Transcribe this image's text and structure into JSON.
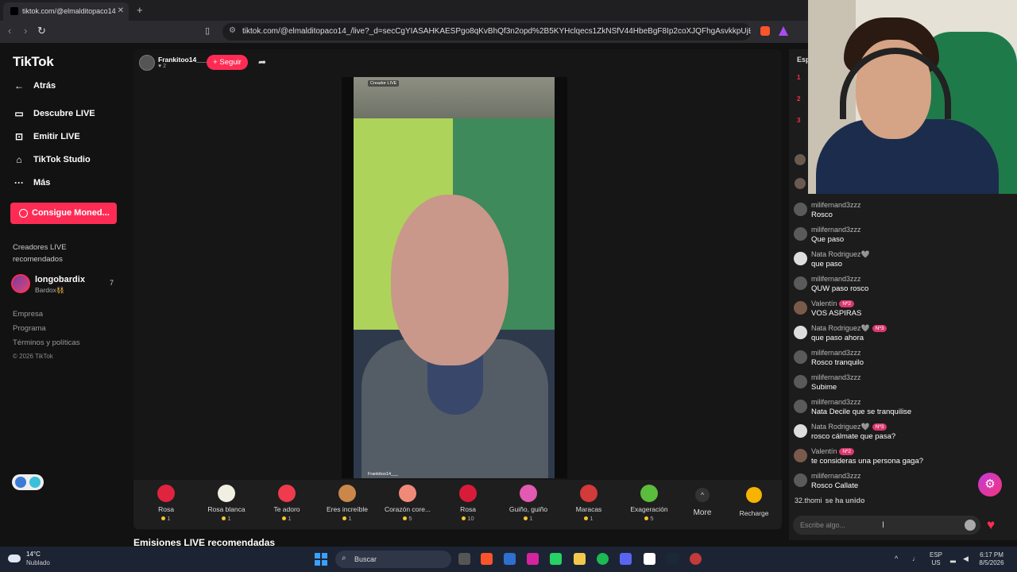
{
  "browser": {
    "tab_title": "tiktok.com/@elmalditopaco14",
    "tab_close": "✕",
    "new_tab": "+",
    "url": "tiktok.com/@elmalditopaco14_/live?_d=secCgYIASAHKAESPgo8qKvBhQf3n2opd%2B5KYHclqecs1ZkNSfV44HbeBgF8Ip2coXJQFhgAsvkkpUjEZaVP4MpOl..."
  },
  "sidebar": {
    "logo": "TikTok",
    "back": "Atrás",
    "nav": [
      {
        "label": "Descubre LIVE",
        "icon": "▭"
      },
      {
        "label": "Emitir LIVE",
        "icon": "⊡"
      },
      {
        "label": "TikTok Studio",
        "icon": "⌂"
      },
      {
        "label": "Más",
        "icon": "···"
      }
    ],
    "coins_button": "Consigue Moned...",
    "recommended_title": "Creadores LIVE recomendados",
    "creator": {
      "name": "longobardix",
      "sub": "Bardox👯",
      "count": "7"
    },
    "footer": [
      "Empresa",
      "Programa",
      "Términos y políticas"
    ],
    "copyright": "© 2026 TikTok"
  },
  "live": {
    "host_name": "Frankitoo14___",
    "host_likes": "♥ 2",
    "follow": "+ Seguir",
    "creator_tag": "Creador LIVE",
    "video_name": "Frankitoo14___"
  },
  "gifts": [
    {
      "name": "Rosa",
      "price": "1",
      "color": "#e0233f"
    },
    {
      "name": "Rosa blanca",
      "price": "1",
      "color": "#f1efe2"
    },
    {
      "name": "Te adoro",
      "price": "1",
      "color": "#ef3b4d"
    },
    {
      "name": "Eres increíble",
      "price": "1",
      "color": "#c9884a"
    },
    {
      "name": "Corazón core...",
      "price": "5",
      "color": "#f08a78"
    },
    {
      "name": "Rosa",
      "price": "10",
      "color": "#d81b3a"
    },
    {
      "name": "Guiño, guiño",
      "price": "1",
      "color": "#e25ab1"
    },
    {
      "name": "Maracas",
      "price": "1",
      "color": "#d33a3a"
    },
    {
      "name": "Exageración",
      "price": "5",
      "color": "#5cbc3d"
    }
  ],
  "gift_more": "More",
  "gift_more_icon": "^",
  "recharge": "Recharge",
  "recommended_streams": "Emisiones LIVE recomendadas",
  "chat": {
    "header": "Esp",
    "ranks": [
      "1",
      "2",
      "3"
    ],
    "messages": [
      {
        "user": "milifernand3zzz",
        "badge": "",
        "text": "Rosco",
        "avatar": "#5a5a5a"
      },
      {
        "user": "milifernand3zzz",
        "badge": "",
        "text": "Que paso",
        "avatar": "#5a5a5a"
      },
      {
        "user": "Nata Rodriguez🩶",
        "badge": "",
        "text": "que paso",
        "avatar": "#dddddd"
      },
      {
        "user": "milifernand3zzz",
        "badge": "",
        "text": "QUW paso rosco",
        "avatar": "#5a5a5a"
      },
      {
        "user": "Valentín",
        "badge": "Nº2",
        "text": "VOS ASPIRAS",
        "avatar": "#7a5a4a"
      },
      {
        "user": "Nata Rodriguez🩶",
        "badge": "Nº3",
        "text": "que paso ahora",
        "avatar": "#dddddd"
      },
      {
        "user": "milifernand3zzz",
        "badge": "",
        "text": "Rosco tranquilo",
        "avatar": "#5a5a5a"
      },
      {
        "user": "milifernand3zzz",
        "badge": "",
        "text": "Subime",
        "avatar": "#5a5a5a"
      },
      {
        "user": "milifernand3zzz",
        "badge": "",
        "text": "Nata Decile que se tranquilise",
        "avatar": "#5a5a5a"
      },
      {
        "user": "Nata Rodriguez🩶",
        "badge": "Nº3",
        "text": "rosco cálmate que pasa?",
        "avatar": "#dddddd"
      },
      {
        "user": "Valentín",
        "badge": "Nº2",
        "text": "te consideras una persona gaga?",
        "avatar": "#7a5a4a"
      },
      {
        "user": "milifernand3zzz",
        "badge": "",
        "text": "Rosco Callate",
        "avatar": "#5a5a5a"
      }
    ],
    "joined_user": "32.thomi",
    "joined_text": "se ha unido",
    "input_placeholder": "Escribe algo...",
    "heart_icon": "♥",
    "gear_icon": "⚙"
  },
  "taskbar": {
    "temp": "14°C",
    "weather": "Nublado",
    "search": "Buscar",
    "lang1": "ESP",
    "lang2": "US",
    "time": "6:17 PM",
    "date": "8/5/2026"
  }
}
